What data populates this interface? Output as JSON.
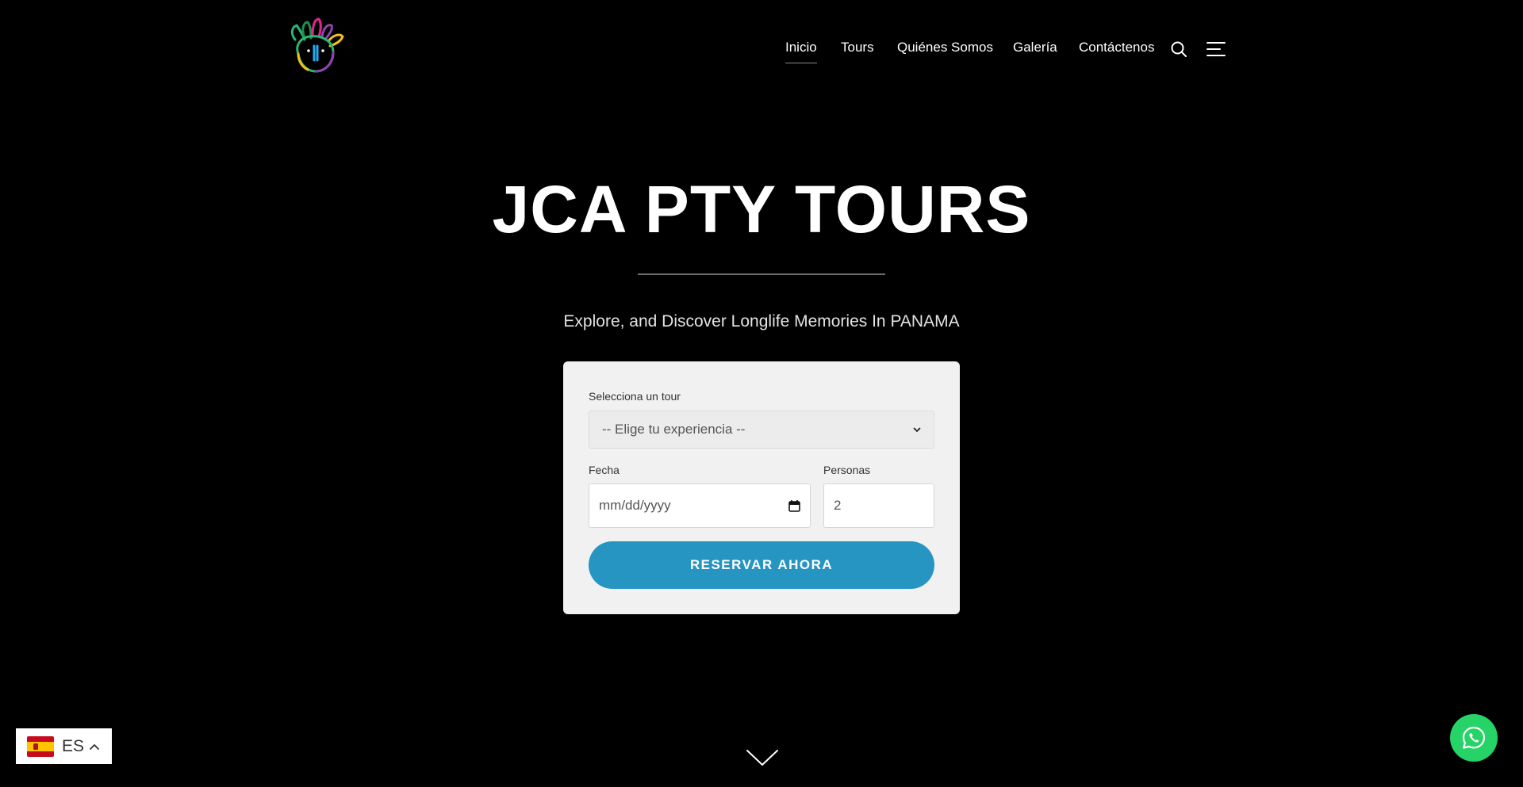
{
  "header": {
    "nav": [
      {
        "label": "Inicio",
        "active": true
      },
      {
        "label": "Tours"
      },
      {
        "label": "Quiénes Somos"
      },
      {
        "label": "Galería"
      },
      {
        "label": "Contáctenos"
      }
    ],
    "icons": [
      "search-icon",
      "menu-icon"
    ]
  },
  "hero": {
    "title": "JCA PTY TOURS",
    "subtitle": "Explore, and Discover Longlife Memories In PANAMA"
  },
  "booking": {
    "tour_label": "Selecciona un tour",
    "tour_selected": "-- Elige tu experiencia --",
    "date_label": "Fecha",
    "date_placeholder": "mm/dd/yyyy",
    "people_label": "Personas",
    "people_value": "2",
    "submit_label": "RESERVAR AHORA"
  },
  "language": {
    "code": "ES"
  },
  "colors": {
    "background": "#000000",
    "card": "#f1f1f1",
    "accent": "#2795c2",
    "whatsapp": "#25d366"
  }
}
